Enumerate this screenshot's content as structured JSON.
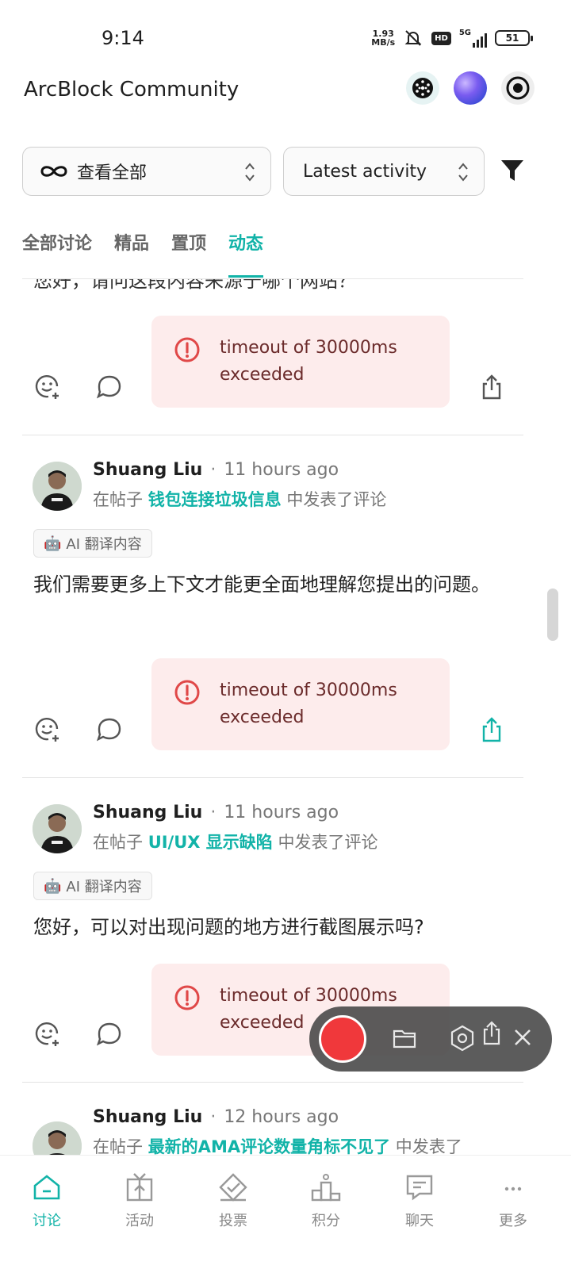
{
  "status": {
    "time": "9:14",
    "net_speed_value": "1.93",
    "net_speed_unit": "MB/s",
    "hd_label": "HD",
    "signal_label": "5G",
    "battery": "51"
  },
  "header": {
    "title": "ArcBlock Community"
  },
  "filters": {
    "scope_label": "查看全部",
    "sort_label": "Latest activity"
  },
  "tabs": [
    {
      "label": "全部讨论"
    },
    {
      "label": "精品"
    },
    {
      "label": "置顶"
    },
    {
      "label": "动态"
    }
  ],
  "feed": {
    "partial_text": "您好，请问这段内容来源于哪个网站？",
    "cards": [
      {
        "error_line1": "timeout of 30000ms",
        "error_line2": "exceeded"
      },
      {
        "author": "Shuang Liu",
        "time": "11 hours ago",
        "post_prefix": "在帖子",
        "post_title": "钱包连接垃圾信息",
        "post_suffix": "中发表了评论",
        "ai_chip": "AI 翻译内容",
        "body": "我们需要更多上下文才能更全面地理解您提出的问题。",
        "error_line1": "timeout of 30000ms",
        "error_line2": "exceeded"
      },
      {
        "author": "Shuang Liu",
        "time": "11 hours ago",
        "post_prefix": "在帖子",
        "post_title": "UI/UX 显示缺陷",
        "post_suffix": "中发表了评论",
        "ai_chip": "AI 翻译内容",
        "body": "您好，可以对出现问题的地方进行截图展示吗?",
        "error_line1": "timeout of 30000ms",
        "error_line2": "exceeded"
      },
      {
        "author": "Shuang Liu",
        "time": "12 hours ago",
        "post_prefix": "在帖子",
        "post_title": "最新的AMA评论数量角标不见了",
        "post_suffix": "中发表了"
      }
    ]
  },
  "bottom_nav": [
    {
      "label": "讨论",
      "icon": "home-icon"
    },
    {
      "label": "活动",
      "icon": "gift-icon"
    },
    {
      "label": "投票",
      "icon": "vote-icon"
    },
    {
      "label": "积分",
      "icon": "podium-icon"
    },
    {
      "label": "聊天",
      "icon": "chat-icon"
    },
    {
      "label": "更多",
      "icon": "more-icon"
    }
  ],
  "colors": {
    "accent": "#12b3a8",
    "error_bg": "#fdecec",
    "error_icon": "#e04848",
    "record": "#f0383b"
  }
}
